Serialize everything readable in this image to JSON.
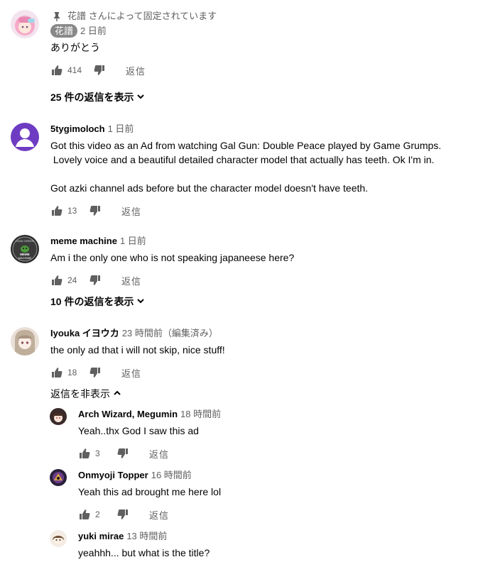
{
  "comments": [
    {
      "pinned_text": "花譜 さんによって固定されています",
      "author": "花譜",
      "time": "2 日前",
      "text": "ありがとう",
      "likes": "414",
      "reply_label": "返信",
      "replies_toggle": "25 件の返信を表示"
    },
    {
      "author": "5tygimoloch",
      "time": "1 日前",
      "text": "Got this video as an Ad from watching Gal Gun: Double Peace played by Game Grumps.\n Lovely voice and a beautiful detailed character model that actually has teeth. Ok I'm in.\n\nGot azki channel ads before but the character model doesn't have teeth.",
      "likes": "13",
      "reply_label": "返信"
    },
    {
      "author": "meme machine",
      "time": "1 日前",
      "text": "Am i the only one who is not speaking japaneese here?",
      "likes": "24",
      "reply_label": "返信",
      "replies_toggle": "10 件の返信を表示"
    },
    {
      "author": "Iyouka イヨウカ",
      "time": "23 時間前（編集済み）",
      "text": "the only ad that i will not skip, nice stuff!",
      "likes": "18",
      "reply_label": "返信",
      "replies_toggle": "返信を非表示"
    }
  ],
  "replies": [
    {
      "author": "Arch Wizard, Megumin",
      "time": "18 時間前",
      "text": "Yeah..thx God I saw this ad",
      "likes": "3",
      "reply_label": "返信"
    },
    {
      "author": "Onmyoji Topper",
      "time": "16 時間前",
      "text": "Yeah this ad brought me here lol",
      "likes": "2",
      "reply_label": "返信"
    },
    {
      "author": "yuki mirae",
      "time": "13 時間前",
      "text": "yeahhh... but what is the title?"
    }
  ],
  "avatar_texts": {
    "meme_machine": [
      "LEAN GREEN",
      "MEME",
      "MACHINE"
    ]
  },
  "colors": {
    "secondary_text": "#606060",
    "primary_text": "#030303",
    "badge_bg": "#888888"
  }
}
